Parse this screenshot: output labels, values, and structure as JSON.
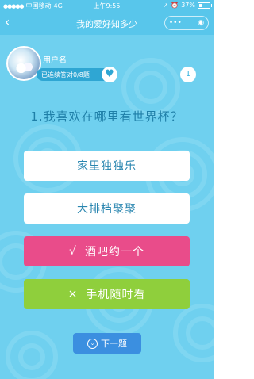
{
  "status_bar": {
    "carrier": "中国移动",
    "network": "4G",
    "time": "上午9:55",
    "battery": "37%",
    "battery_level": 0.37
  },
  "nav": {
    "title": "我的爱好知多少",
    "back_icon": "chevron-left-icon",
    "more_icon": "more-dots-icon",
    "target_icon": "target-icon"
  },
  "user": {
    "name": "用户名",
    "streak": "已连续答对0/8题",
    "heart_icon": "heart-icon"
  },
  "question_number": "1",
  "question": "1.我喜欢在哪里看世界杯？",
  "options": [
    {
      "label": "家里独独乐",
      "mark": "",
      "state": "default"
    },
    {
      "label": "大排档聚聚",
      "mark": "",
      "state": "default"
    },
    {
      "label": "酒吧约一个",
      "mark": "√",
      "state": "correct"
    },
    {
      "label": "手机随时看",
      "mark": "×",
      "state": "wrong"
    }
  ],
  "next_button": {
    "label": "下一题",
    "icon": "chevron-down-circle-icon"
  },
  "colors": {
    "background": "#6fd0ef",
    "bar": "#58c6eb",
    "correct": "#e94c8a",
    "wrong": "#8fcf3c",
    "button": "#3b8fe0"
  }
}
